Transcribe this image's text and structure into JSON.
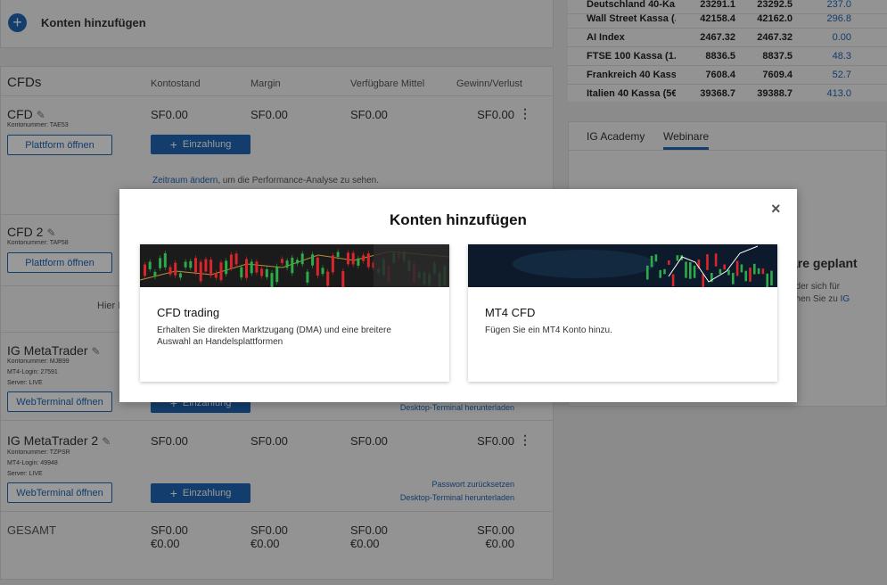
{
  "add_account": {
    "label": "Konten hinzufügen"
  },
  "cfds": {
    "title": "CFDs",
    "columns": [
      "Kontostand",
      "Margin",
      "Verfügbare Mittel",
      "Gewinn/Verlust"
    ],
    "accounts": [
      {
        "name": "CFD",
        "meta": [
          "Kontonummer: TAE53"
        ],
        "balance": "SF0.00",
        "margin": "SF0.00",
        "available": "SF0.00",
        "pl": "SF0.00",
        "open_button": "Plattform öffnen",
        "deposit_button": "Einzahlung"
      },
      {
        "name": "CFD 2",
        "meta": [
          "Kontonummer: TAP58"
        ],
        "open_button": "Plattform öffnen"
      },
      {
        "name": "IG MetaTrader",
        "meta": [
          "Kontonummer: MJB99",
          "MT4-Login: 27591",
          "Server: LIVE"
        ],
        "open_button": "WebTerminal öffnen",
        "deposit_button": "Einzahlung",
        "links": [
          "Desktop-Terminal herunterladen"
        ]
      },
      {
        "name": "IG MetaTrader 2",
        "meta": [
          "Kontonummer: TZPSR",
          "MT4-Login: 49948",
          "Server: LIVE"
        ],
        "balance": "SF0.00",
        "margin": "SF0.00",
        "available": "SF0.00",
        "pl": "SF0.00",
        "open_button": "WebTerminal öffnen",
        "deposit_button": "Einzahlung",
        "links": [
          "Passwort zurücksetzen",
          "Desktop-Terminal herunterladen"
        ]
      }
    ],
    "performance": {
      "link": "Zeitraum ändern",
      "text": ", um die Performance-Analyse zu sehen."
    },
    "partial_text": "Hier I",
    "total": {
      "label": "GESAMT",
      "balance": [
        "SF0.00",
        "€0.00"
      ],
      "margin": [
        "SF0.00",
        "€0.00"
      ],
      "available": [
        "SF0.00",
        "€0.00"
      ],
      "pl": [
        "SF0.00",
        "€0.00"
      ]
    }
  },
  "markets": [
    {
      "name": "Deutschland 40-Ka...",
      "bid": "23291.1",
      "ask": "23292.5",
      "change": "237.0"
    },
    {
      "name": "Wall Street Kassa (...",
      "bid": "42158.4",
      "ask": "42162.0",
      "change": "296.8"
    },
    {
      "name": "AI Index",
      "bid": "2467.32",
      "ask": "2467.32",
      "change": "0.00"
    },
    {
      "name": "FTSE 100 Kassa (1...",
      "bid": "8836.5",
      "ask": "8837.5",
      "change": "48.3"
    },
    {
      "name": "Frankreich 40 Kass...",
      "bid": "7608.4",
      "ask": "7609.4",
      "change": "52.7"
    },
    {
      "name": "Italien 40 Kassa (5€)",
      "bid": "39368.7",
      "ask": "39388.7",
      "change": "413.0"
    }
  ],
  "learning": {
    "tabs": [
      "IG Academy",
      "Webinare"
    ],
    "active_tab": "Webinare",
    "notice_title": "are geplant",
    "notice_line1": " oder sich für",
    "notice_line2": "ehen Sie zu ",
    "notice_link": "IG"
  },
  "modal": {
    "title": "Konten hinzufügen",
    "close": "×",
    "options": [
      {
        "title": "CFD trading",
        "description": "Erhalten Sie direkten Marktzugang (DMA) und eine breitere Auswahl an Handelsplattformen"
      },
      {
        "title": "MT4 CFD",
        "description": "Fügen Sie ein MT4 Konto hinzu."
      }
    ]
  },
  "colors": {
    "accent": "#1f66b5",
    "positive": "#2eaa4a",
    "negative": "#d8262b"
  }
}
